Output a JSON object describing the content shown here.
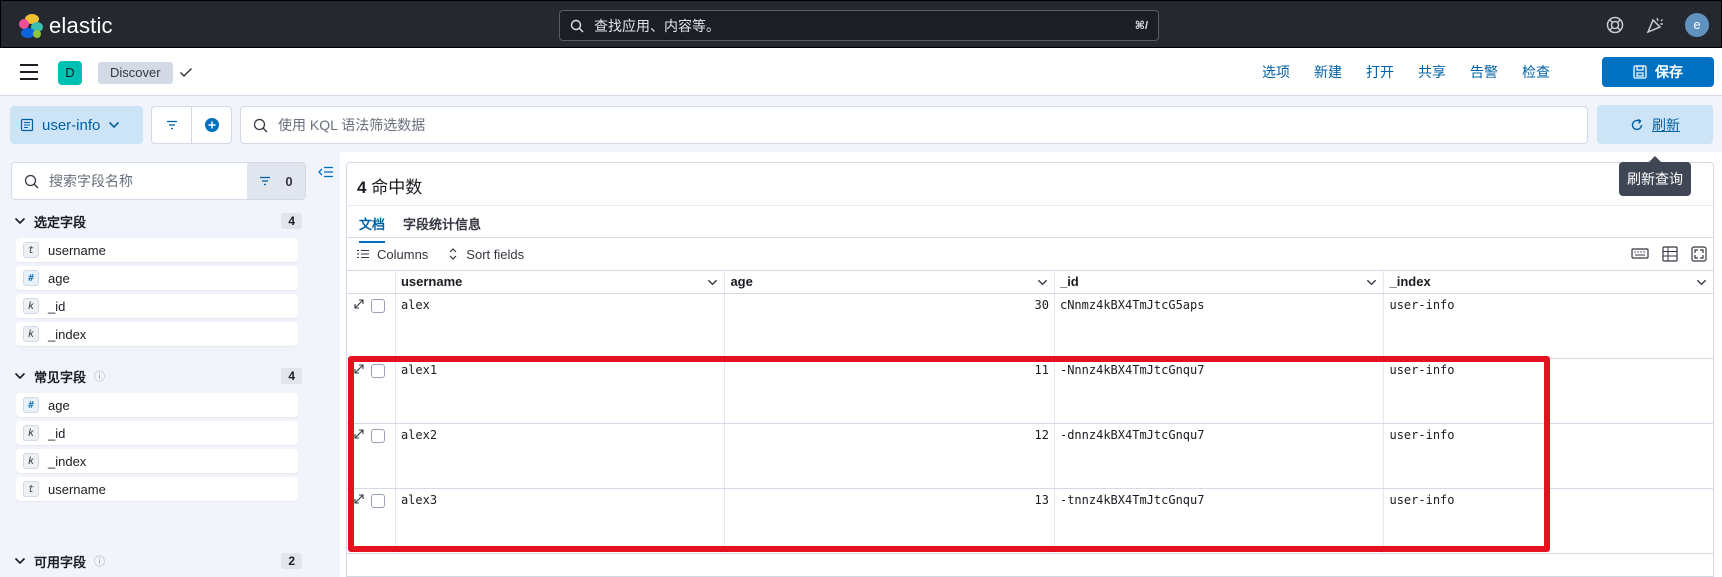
{
  "header": {
    "brand": "elastic",
    "search_placeholder": "查找应用、内容等。",
    "search_shortcut": "⌘/",
    "avatar_initial": "e"
  },
  "appbar": {
    "space_badge": "D",
    "breadcrumb": "Discover",
    "nav": [
      "选项",
      "新建",
      "打开",
      "共享",
      "告警",
      "检查"
    ],
    "save_label": "保存"
  },
  "querybar": {
    "data_view": "user-info",
    "kql_placeholder": "使用 KQL 语法筛选数据",
    "refresh_label": "刷新",
    "refresh_tooltip": "刷新查询"
  },
  "sidebar": {
    "search_placeholder": "搜索字段名称",
    "filter_count": "0",
    "groups": [
      {
        "title": "选定字段",
        "count": "4",
        "fields": [
          {
            "type": "t",
            "name": "username"
          },
          {
            "type": "#",
            "name": "age"
          },
          {
            "type": "k",
            "name": "_id"
          },
          {
            "type": "k",
            "name": "_index"
          }
        ]
      },
      {
        "title": "常见字段",
        "count": "4",
        "fields": [
          {
            "type": "#",
            "name": "age"
          },
          {
            "type": "k",
            "name": "_id"
          },
          {
            "type": "k",
            "name": "_index"
          },
          {
            "type": "t",
            "name": "username"
          }
        ]
      },
      {
        "title": "可用字段",
        "count": "2",
        "fields": []
      }
    ]
  },
  "results": {
    "hits_count": "4",
    "hits_label": "命中数",
    "tabs": [
      "文档",
      "字段统计信息"
    ],
    "toolbar": {
      "columns": "Columns",
      "sort": "Sort fields"
    },
    "columns": [
      "username",
      "age",
      "_id",
      "_index"
    ],
    "rows": [
      {
        "username": "alex",
        "age": "30",
        "_id": "cNnmz4kBX4TmJtcG5aps",
        "_index": "user-info"
      },
      {
        "username": "alex1",
        "age": "11",
        "_id": "-Nnnz4kBX4TmJtcGnqu7",
        "_index": "user-info"
      },
      {
        "username": "alex2",
        "age": "12",
        "_id": "-dnnz4kBX4TmJtcGnqu7",
        "_index": "user-info"
      },
      {
        "username": "alex3",
        "age": "13",
        "_id": "-tnnz4kBX4TmJtcGnqu7",
        "_index": "user-info"
      }
    ]
  },
  "colors": {
    "accent": "#0071c2",
    "highlight": "#e4121f",
    "header_bg": "#25282f"
  }
}
